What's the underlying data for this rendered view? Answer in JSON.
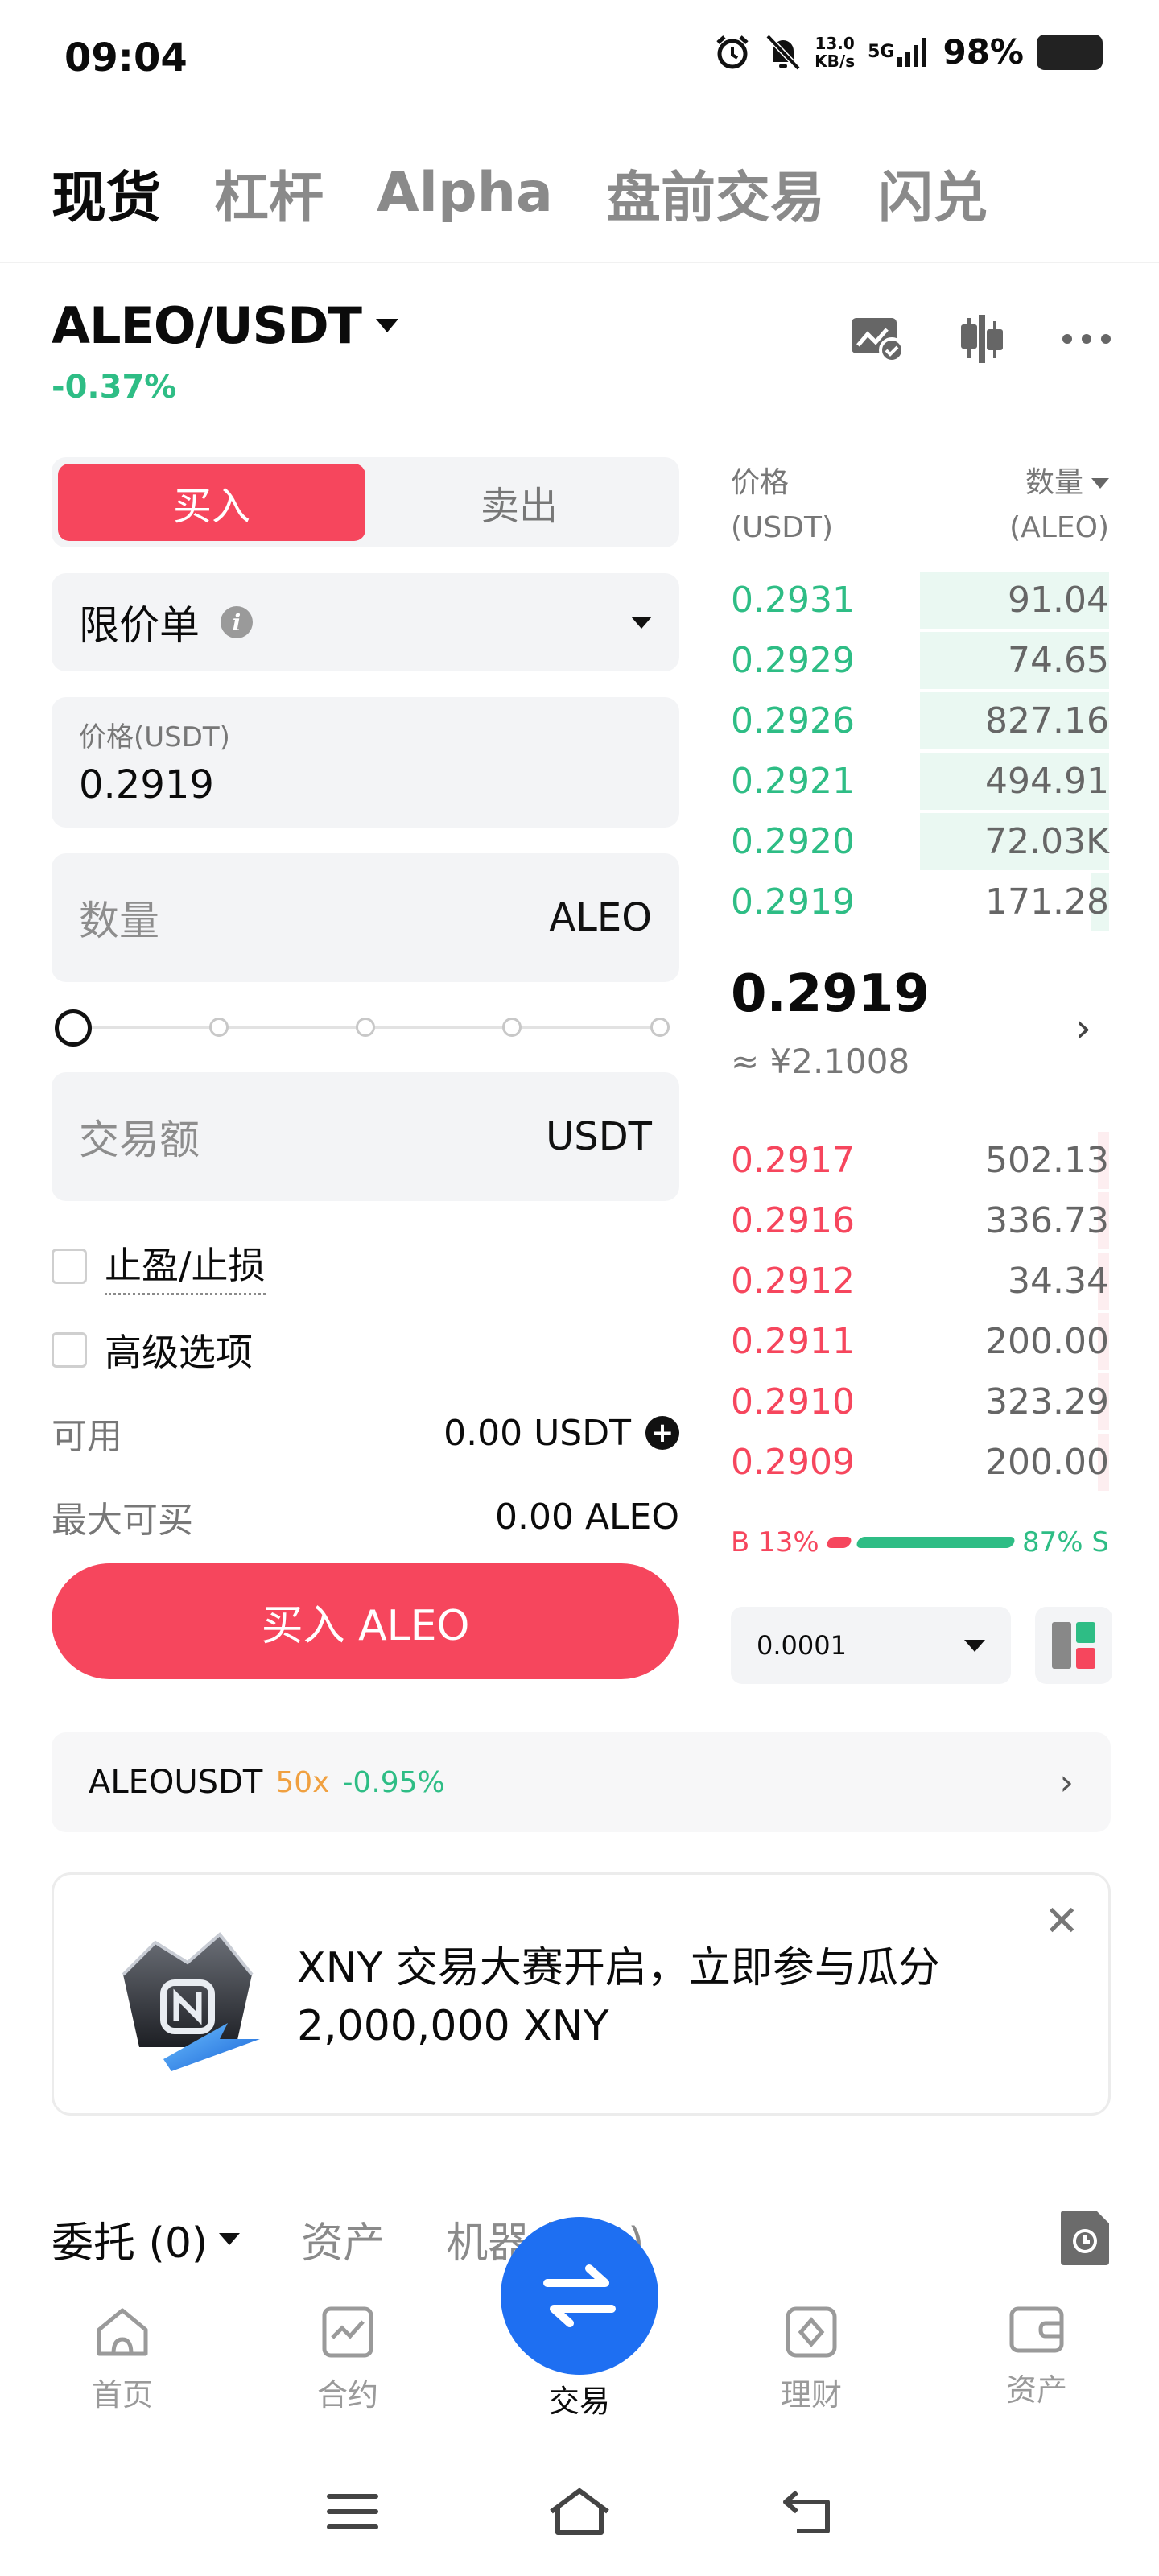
{
  "status_bar": {
    "time": "09:04",
    "net_speed_value": "13.0",
    "net_speed_unit": "KB/s",
    "network": "5G",
    "battery": "98%"
  },
  "top_tabs": [
    "现货",
    "杠杆",
    "Alpha",
    "盘前交易",
    "闪兑"
  ],
  "pair": {
    "symbol": "ALEO/USDT",
    "change": "-0.37%"
  },
  "trade": {
    "buy_tab": "买入",
    "sell_tab": "卖出",
    "order_type": "限价单",
    "price_label": "价格(USDT)",
    "price_value": "0.2919",
    "qty_placeholder": "数量",
    "qty_unit": "ALEO",
    "amount_placeholder": "交易额",
    "amount_unit": "USDT",
    "tp_sl": "止盈/止损",
    "advanced": "高级选项",
    "available_label": "可用",
    "available_value": "0.00 USDT",
    "max_buy_label": "最大可买",
    "max_buy_value": "0.00 ALEO",
    "submit": "买入 ALEO",
    "slider_percent": 0
  },
  "orderbook": {
    "price_header_1": "价格",
    "price_header_2": "(USDT)",
    "qty_header_1": "数量",
    "qty_header_2": "(ALEO)",
    "asks": [
      {
        "price": "0.2931",
        "qty": "91.04",
        "depth": 0.5
      },
      {
        "price": "0.2929",
        "qty": "74.65",
        "depth": 0.5
      },
      {
        "price": "0.2926",
        "qty": "827.16",
        "depth": 0.5
      },
      {
        "price": "0.2921",
        "qty": "494.91",
        "depth": 0.5
      },
      {
        "price": "0.2920",
        "qty": "72.03K",
        "depth": 0.5
      },
      {
        "price": "0.2919",
        "qty": "171.28",
        "depth": 0.05
      }
    ],
    "last_price": "0.2919",
    "fiat_price": "≈ ¥2.1008",
    "bids": [
      {
        "price": "0.2917",
        "qty": "502.13",
        "depth": 0.03
      },
      {
        "price": "0.2916",
        "qty": "336.73",
        "depth": 0.03
      },
      {
        "price": "0.2912",
        "qty": "34.34",
        "depth": 0.03
      },
      {
        "price": "0.2911",
        "qty": "200.00",
        "depth": 0.03
      },
      {
        "price": "0.2910",
        "qty": "323.29",
        "depth": 0.03
      },
      {
        "price": "0.2909",
        "qty": "200.00",
        "depth": 0.03
      }
    ],
    "buy_ratio": "B 13%",
    "sell_ratio": "87% S",
    "buy_ratio_value": 13,
    "precision": "0.0001"
  },
  "futures": {
    "symbol": "ALEOUSDT",
    "leverage": "50x",
    "change": "-0.95%"
  },
  "banner": {
    "line1": "XNY 交易大赛开启，立即参与瓜分",
    "line2": "2,000,000 XNY"
  },
  "bottom_tabs": {
    "orders": "委托 (0)",
    "assets": "资产",
    "bots": "机器人 (0)"
  },
  "nav": [
    "首页",
    "合约",
    "交易",
    "理财",
    "资产"
  ],
  "colors": {
    "buy": "#f6465d",
    "up": "#2ebd85",
    "accent": "#1e6ff2"
  }
}
